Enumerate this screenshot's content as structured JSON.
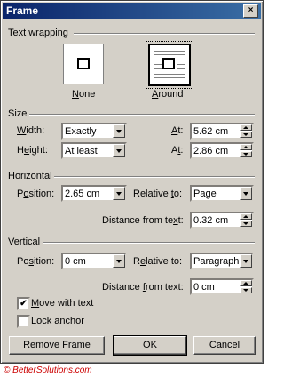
{
  "window": {
    "title": "Frame",
    "close_glyph": "×"
  },
  "text_wrapping": {
    "group_label": "Text wrapping",
    "options": [
      {
        "label": "None",
        "mnemonic": "N",
        "rest": "one",
        "selected": false
      },
      {
        "label": "Around",
        "mnemonic": "A",
        "rest": "round",
        "selected": true
      }
    ]
  },
  "size": {
    "group_label": "Size",
    "width_label": "Width:",
    "width_mn": "W",
    "width_rest": "idth:",
    "width_value": "Exactly",
    "width_at_label": "At:",
    "width_at_mn": "A",
    "width_at_rest": "t:",
    "width_at_value": "5.62 cm",
    "height_label": "Height:",
    "height_mn": "e",
    "height_pre": "H",
    "height_rest": "ight:",
    "height_value": "At least",
    "height_at_label": "At:",
    "height_at_mn": "t",
    "height_at_pre": "A",
    "height_at_rest": ":",
    "height_at_value": "2.86 cm"
  },
  "horizontal": {
    "group_label": "Horizontal",
    "position_pre": "P",
    "position_mn": "o",
    "position_rest": "sition:",
    "position_value": "2.65 cm",
    "relative_pre": "Relative ",
    "relative_mn": "t",
    "relative_rest": "o:",
    "relative_value": "Page",
    "distance_pre": "Distance from te",
    "distance_mn": "x",
    "distance_rest": "t:",
    "distance_value": "0.32 cm"
  },
  "vertical": {
    "group_label": "Vertical",
    "position_pre": "Po",
    "position_mn": "s",
    "position_rest": "ition:",
    "position_value": "0 cm",
    "relative_pre": "R",
    "relative_mn": "e",
    "relative_rest": "lative to:",
    "relative_value": "Paragraph",
    "distance_pre": "Distance ",
    "distance_mn": "f",
    "distance_rest": "rom text:",
    "distance_value": "0 cm",
    "move_with_text": {
      "mn": "M",
      "rest": "ove with text",
      "checked": true,
      "check_glyph": "✔"
    },
    "lock_anchor": {
      "pre": "Loc",
      "mn": "k",
      "rest": " anchor",
      "checked": false
    }
  },
  "buttons": {
    "remove_mn": "R",
    "remove_rest": "emove Frame",
    "ok": "OK",
    "cancel": "Cancel"
  },
  "footer": {
    "copyright": "© BetterSolutions.com"
  }
}
